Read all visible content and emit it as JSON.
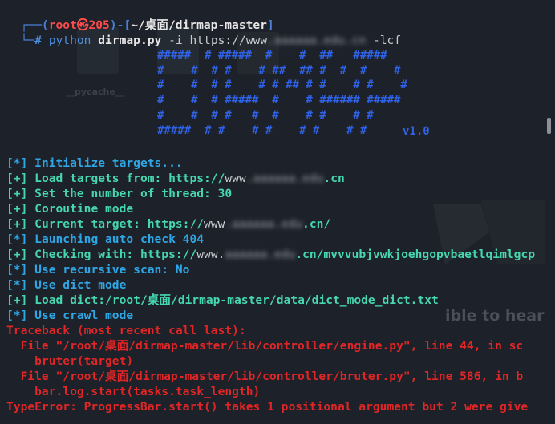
{
  "prompt": {
    "frame_top": "┌──(",
    "user": "root㉿205",
    "sep": ")-[",
    "path": "~/桌面/dirmap-master",
    "close": "]",
    "frame_bottom": "└─",
    "hash": "# ",
    "cmd_python": "python ",
    "cmd_script": "dirmap.py",
    "cmd_flag_i": " -i ",
    "cmd_url_prefix": "https://www",
    "cmd_url_blur": ".aaaaaa.edu.cn",
    "cmd_flag_lcf": " -lcf"
  },
  "banner": {
    "art": "#####  # #####  #    #  ##   #####\n#    #  # #    # ##  ## #  #  #    #\n#    #  # #    # # ## # #    # #    #\n#    #  # #####  #    # ###### #####\n#    #  # #   #  #    # #    # #\n#####  # #    # #    # #    # #",
    "version": "v1.0"
  },
  "log": [
    {
      "tag": "[*] ",
      "msg": "Initialize targets...",
      "color": "cyan"
    },
    {
      "tag": "[+] ",
      "msg": "Load targets from: https://",
      "url_prefix": "www",
      "url_blur": ".aaaaaa.edu",
      "suffix": ".cn",
      "color": "green"
    },
    {
      "tag": "[+] ",
      "msg": "Set the number of thread: 30",
      "color": "green"
    },
    {
      "tag": "[+] ",
      "msg": "Coroutine mode",
      "color": "green"
    },
    {
      "tag": "[+] ",
      "msg": "Current target: https://",
      "url_prefix": "www",
      "url_blur": ".aaaaaa.edu",
      "suffix": ".cn/",
      "color": "green"
    },
    {
      "tag": "[*] ",
      "msg": "Launching auto check 404",
      "color": "cyan"
    },
    {
      "tag": "[+] ",
      "msg": "Checking with: https://",
      "url_prefix": "www.",
      "url_blur": "aaaaaa.edu",
      "suffix": ".cn/mvvvubjvwkjoehgopvbaetlqimlgcp",
      "color": "green"
    },
    {
      "tag": "[*] ",
      "msg": "Use recursive scan: No",
      "color": "cyan"
    },
    {
      "tag": "[*] ",
      "msg": "Use dict mode",
      "color": "cyan"
    },
    {
      "tag": "[+] ",
      "msg": "Load dict:/root/桌面/dirmap-master/data/dict_mode_dict.txt",
      "color": "green"
    },
    {
      "tag": "[*] ",
      "msg": "Use crawl mode",
      "color": "cyan"
    }
  ],
  "traceback": [
    "Traceback (most recent call last):",
    "  File \"/root/桌面/dirmap-master/lib/controller/engine.py\", line 44, in sc",
    "    bruter(target)",
    "  File \"/root/桌面/dirmap-master/lib/controller/bruter.py\", line 586, in b",
    "    bar.log.start(tasks.task_length)",
    "TypeError: ProgressBar.start() takes 1 positional argument but 2 were give"
  ],
  "background": {
    "folder_label": "__pycache__",
    "watermark": "ible to hear"
  }
}
